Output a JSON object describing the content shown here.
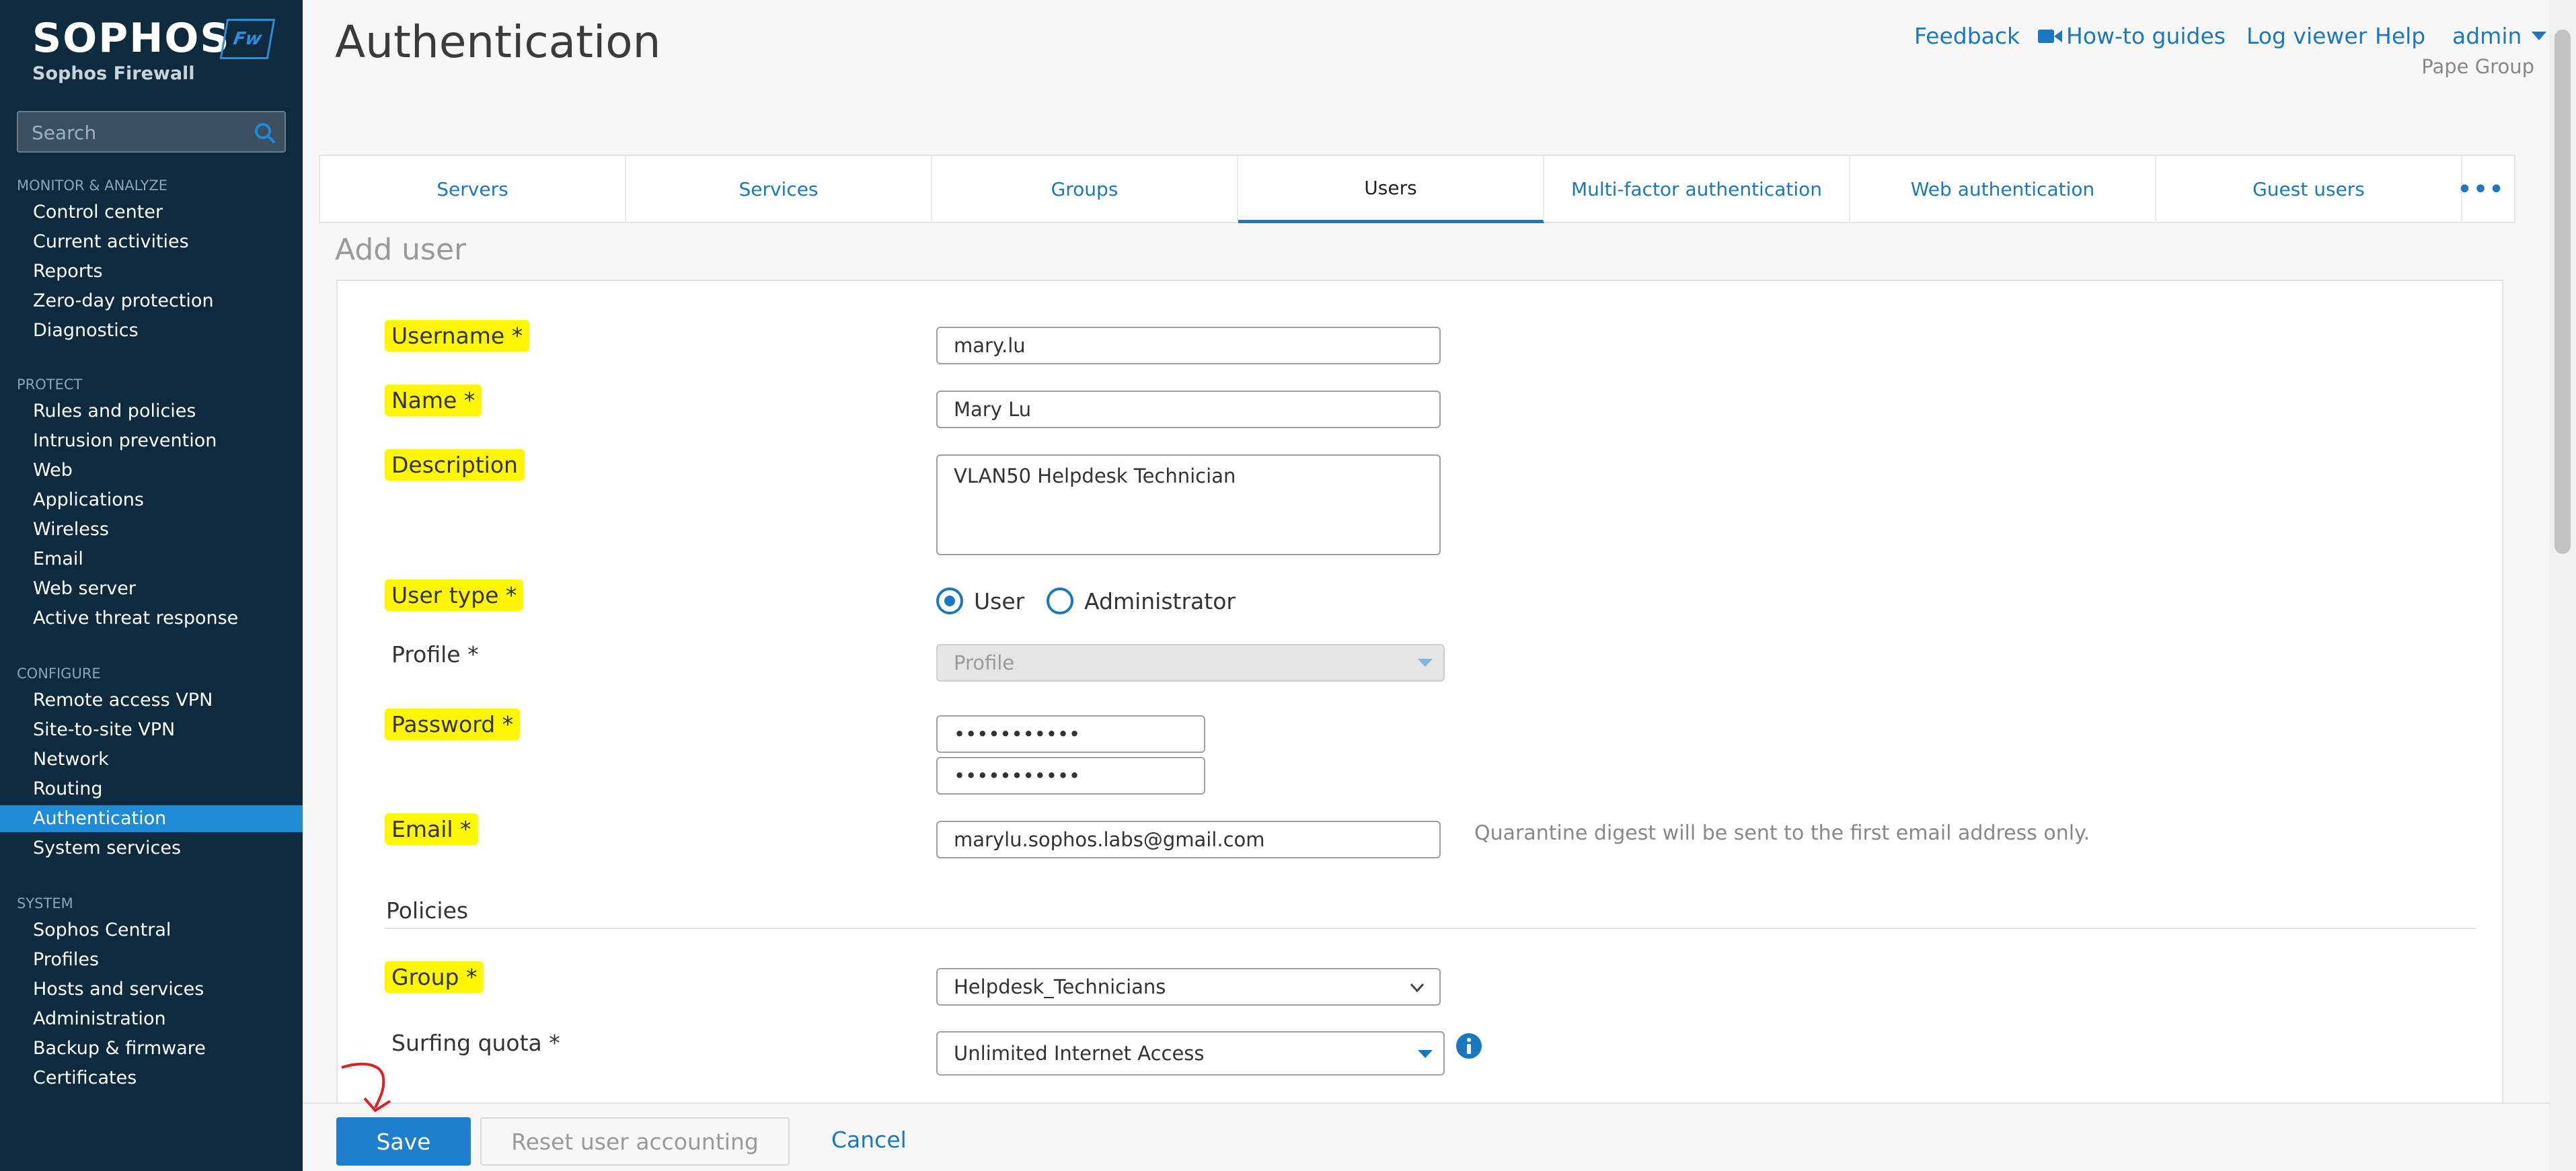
{
  "sidebar": {
    "brand": "SOPHOS",
    "badge": "Fw",
    "product": "Sophos Firewall",
    "search_placeholder": "Search",
    "sections": [
      {
        "title": "MONITOR & ANALYZE",
        "items": [
          "Control center",
          "Current activities",
          "Reports",
          "Zero-day protection",
          "Diagnostics"
        ]
      },
      {
        "title": "PROTECT",
        "items": [
          "Rules and policies",
          "Intrusion prevention",
          "Web",
          "Applications",
          "Wireless",
          "Email",
          "Web server",
          "Active threat response"
        ]
      },
      {
        "title": "CONFIGURE",
        "items": [
          "Remote access VPN",
          "Site-to-site VPN",
          "Network",
          "Routing",
          "Authentication",
          "System services"
        ]
      },
      {
        "title": "SYSTEM",
        "items": [
          "Sophos Central",
          "Profiles",
          "Hosts and services",
          "Administration",
          "Backup & firmware",
          "Certificates"
        ]
      }
    ],
    "active_item": "Authentication"
  },
  "header": {
    "title": "Authentication",
    "links": [
      "Feedback",
      "How-to guides",
      "Log viewer",
      "Help",
      "admin"
    ],
    "org": "Pape Group"
  },
  "tabs": [
    "Servers",
    "Services",
    "Groups",
    "Users",
    "Multi-factor authentication",
    "Web authentication",
    "Guest users"
  ],
  "active_tab": "Users",
  "form": {
    "subtitle": "Add user",
    "labels": {
      "username": "Username *",
      "name": "Name *",
      "description": "Description",
      "user_type": "User type *",
      "profile": "Profile *",
      "password": "Password *",
      "email": "Email *",
      "policies": "Policies",
      "group": "Group *",
      "surfing_quota": "Surfing quota *"
    },
    "values": {
      "username": "mary.lu",
      "name": "Mary Lu",
      "description": "VLAN50 Helpdesk Technician",
      "profile": "Profile",
      "password": "•••••••••••",
      "password_confirm": "•••••••••••",
      "email": "marylu.sophos.labs@gmail.com",
      "group": "Helpdesk_Technicians",
      "surfing_quota": "Unlimited Internet Access"
    },
    "user_type_options": [
      "User",
      "Administrator"
    ],
    "user_type_selected": "User",
    "email_hint": "Quarantine digest will be sent to the first email address only."
  },
  "footer": {
    "save": "Save",
    "reset": "Reset user accounting",
    "cancel": "Cancel"
  },
  "colors": {
    "sidebar_bg": "#0e2a3f",
    "accent": "#1a78c2",
    "highlight": "#fff700",
    "annotation": "#e02020"
  }
}
